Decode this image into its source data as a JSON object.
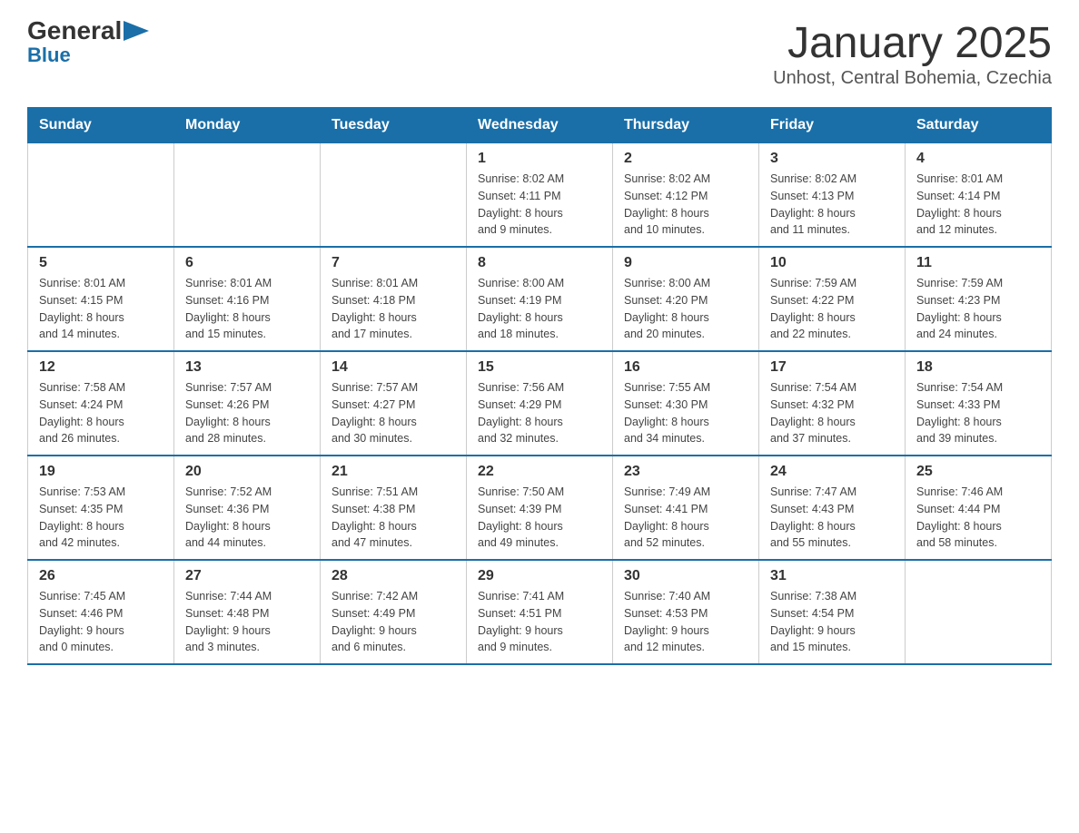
{
  "logo": {
    "general": "General",
    "blue": "Blue",
    "arrow": "▶"
  },
  "title": "January 2025",
  "subtitle": "Unhost, Central Bohemia, Czechia",
  "days_of_week": [
    "Sunday",
    "Monday",
    "Tuesday",
    "Wednesday",
    "Thursday",
    "Friday",
    "Saturday"
  ],
  "weeks": [
    [
      {
        "day": "",
        "info": ""
      },
      {
        "day": "",
        "info": ""
      },
      {
        "day": "",
        "info": ""
      },
      {
        "day": "1",
        "info": "Sunrise: 8:02 AM\nSunset: 4:11 PM\nDaylight: 8 hours\nand 9 minutes."
      },
      {
        "day": "2",
        "info": "Sunrise: 8:02 AM\nSunset: 4:12 PM\nDaylight: 8 hours\nand 10 minutes."
      },
      {
        "day": "3",
        "info": "Sunrise: 8:02 AM\nSunset: 4:13 PM\nDaylight: 8 hours\nand 11 minutes."
      },
      {
        "day": "4",
        "info": "Sunrise: 8:01 AM\nSunset: 4:14 PM\nDaylight: 8 hours\nand 12 minutes."
      }
    ],
    [
      {
        "day": "5",
        "info": "Sunrise: 8:01 AM\nSunset: 4:15 PM\nDaylight: 8 hours\nand 14 minutes."
      },
      {
        "day": "6",
        "info": "Sunrise: 8:01 AM\nSunset: 4:16 PM\nDaylight: 8 hours\nand 15 minutes."
      },
      {
        "day": "7",
        "info": "Sunrise: 8:01 AM\nSunset: 4:18 PM\nDaylight: 8 hours\nand 17 minutes."
      },
      {
        "day": "8",
        "info": "Sunrise: 8:00 AM\nSunset: 4:19 PM\nDaylight: 8 hours\nand 18 minutes."
      },
      {
        "day": "9",
        "info": "Sunrise: 8:00 AM\nSunset: 4:20 PM\nDaylight: 8 hours\nand 20 minutes."
      },
      {
        "day": "10",
        "info": "Sunrise: 7:59 AM\nSunset: 4:22 PM\nDaylight: 8 hours\nand 22 minutes."
      },
      {
        "day": "11",
        "info": "Sunrise: 7:59 AM\nSunset: 4:23 PM\nDaylight: 8 hours\nand 24 minutes."
      }
    ],
    [
      {
        "day": "12",
        "info": "Sunrise: 7:58 AM\nSunset: 4:24 PM\nDaylight: 8 hours\nand 26 minutes."
      },
      {
        "day": "13",
        "info": "Sunrise: 7:57 AM\nSunset: 4:26 PM\nDaylight: 8 hours\nand 28 minutes."
      },
      {
        "day": "14",
        "info": "Sunrise: 7:57 AM\nSunset: 4:27 PM\nDaylight: 8 hours\nand 30 minutes."
      },
      {
        "day": "15",
        "info": "Sunrise: 7:56 AM\nSunset: 4:29 PM\nDaylight: 8 hours\nand 32 minutes."
      },
      {
        "day": "16",
        "info": "Sunrise: 7:55 AM\nSunset: 4:30 PM\nDaylight: 8 hours\nand 34 minutes."
      },
      {
        "day": "17",
        "info": "Sunrise: 7:54 AM\nSunset: 4:32 PM\nDaylight: 8 hours\nand 37 minutes."
      },
      {
        "day": "18",
        "info": "Sunrise: 7:54 AM\nSunset: 4:33 PM\nDaylight: 8 hours\nand 39 minutes."
      }
    ],
    [
      {
        "day": "19",
        "info": "Sunrise: 7:53 AM\nSunset: 4:35 PM\nDaylight: 8 hours\nand 42 minutes."
      },
      {
        "day": "20",
        "info": "Sunrise: 7:52 AM\nSunset: 4:36 PM\nDaylight: 8 hours\nand 44 minutes."
      },
      {
        "day": "21",
        "info": "Sunrise: 7:51 AM\nSunset: 4:38 PM\nDaylight: 8 hours\nand 47 minutes."
      },
      {
        "day": "22",
        "info": "Sunrise: 7:50 AM\nSunset: 4:39 PM\nDaylight: 8 hours\nand 49 minutes."
      },
      {
        "day": "23",
        "info": "Sunrise: 7:49 AM\nSunset: 4:41 PM\nDaylight: 8 hours\nand 52 minutes."
      },
      {
        "day": "24",
        "info": "Sunrise: 7:47 AM\nSunset: 4:43 PM\nDaylight: 8 hours\nand 55 minutes."
      },
      {
        "day": "25",
        "info": "Sunrise: 7:46 AM\nSunset: 4:44 PM\nDaylight: 8 hours\nand 58 minutes."
      }
    ],
    [
      {
        "day": "26",
        "info": "Sunrise: 7:45 AM\nSunset: 4:46 PM\nDaylight: 9 hours\nand 0 minutes."
      },
      {
        "day": "27",
        "info": "Sunrise: 7:44 AM\nSunset: 4:48 PM\nDaylight: 9 hours\nand 3 minutes."
      },
      {
        "day": "28",
        "info": "Sunrise: 7:42 AM\nSunset: 4:49 PM\nDaylight: 9 hours\nand 6 minutes."
      },
      {
        "day": "29",
        "info": "Sunrise: 7:41 AM\nSunset: 4:51 PM\nDaylight: 9 hours\nand 9 minutes."
      },
      {
        "day": "30",
        "info": "Sunrise: 7:40 AM\nSunset: 4:53 PM\nDaylight: 9 hours\nand 12 minutes."
      },
      {
        "day": "31",
        "info": "Sunrise: 7:38 AM\nSunset: 4:54 PM\nDaylight: 9 hours\nand 15 minutes."
      },
      {
        "day": "",
        "info": ""
      }
    ]
  ]
}
